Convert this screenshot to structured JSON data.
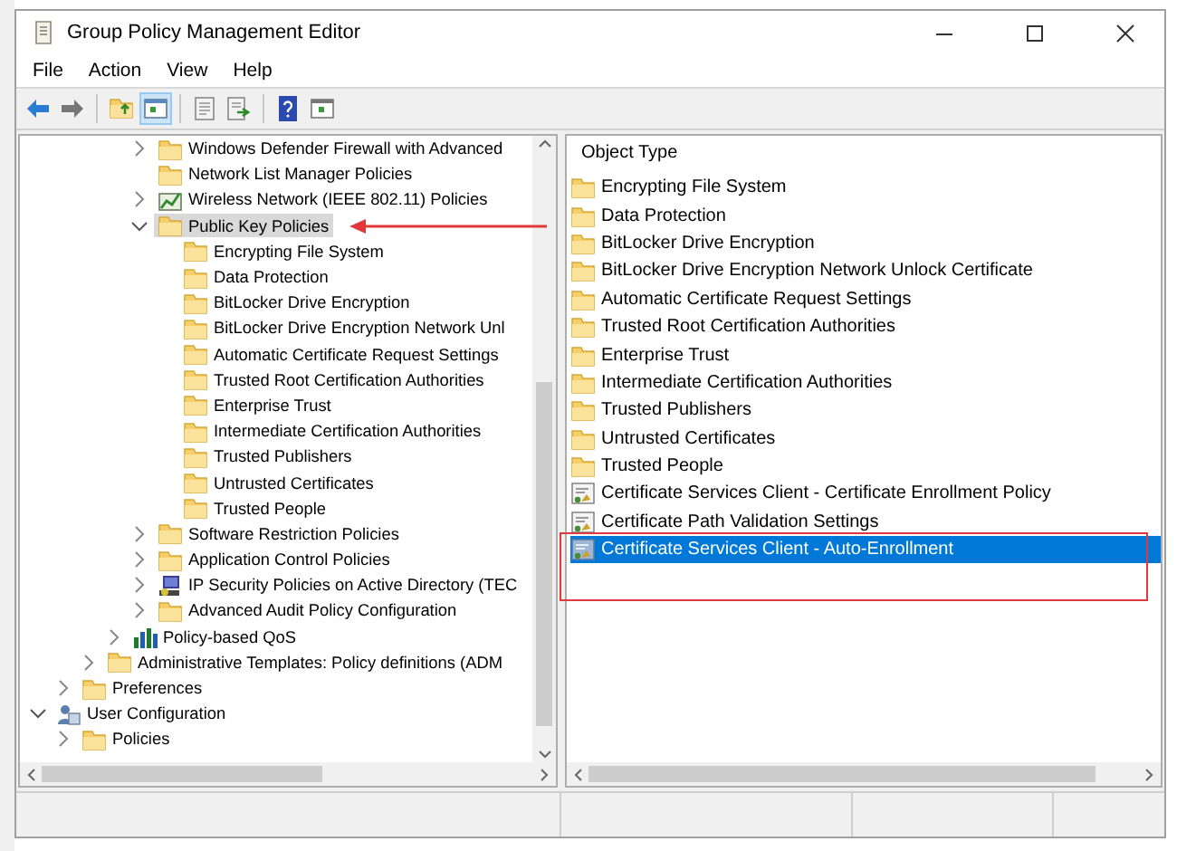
{
  "window": {
    "title": "Group Policy Management Editor"
  },
  "menu": [
    "File",
    "Action",
    "View",
    "Help"
  ],
  "toolbar": [
    {
      "kind": "back",
      "pressed": false
    },
    {
      "kind": "forward",
      "pressed": false
    },
    {
      "kind": "up",
      "pressed": false
    },
    {
      "kind": "tree",
      "pressed": true
    },
    {
      "kind": "sheet",
      "pressed": false
    },
    {
      "kind": "export",
      "pressed": false
    },
    {
      "kind": "help",
      "pressed": false
    },
    {
      "kind": "view",
      "pressed": false
    }
  ],
  "tree": [
    {
      "children": [
        {
          "children": [
            {
              "children": [
                {
                  "children": [
                    {
                      "label": "Windows Defender Firewall with Advanced",
                      "kind": "folder",
                      "expanded": false,
                      "selected": false
                    },
                    {
                      "label": "Network List Manager Policies",
                      "kind": "folder",
                      "selected": false
                    },
                    {
                      "label": "Wireless Network (IEEE 802.11) Policies",
                      "kind": "wireless",
                      "expanded": false,
                      "selected": false
                    },
                    {
                      "label": "Public Key Policies",
                      "kind": "folder",
                      "expanded": true,
                      "selected": true,
                      "children": [
                        {
                          "label": "Encrypting File System",
                          "kind": "folder",
                          "selected": false
                        },
                        {
                          "label": "Data Protection",
                          "kind": "folder",
                          "selected": false
                        },
                        {
                          "label": "BitLocker Drive Encryption",
                          "kind": "folder",
                          "selected": false
                        },
                        {
                          "label": "BitLocker Drive Encryption Network Unl",
                          "kind": "folder",
                          "selected": false
                        },
                        {
                          "label": "Automatic Certificate Request Settings",
                          "kind": "folder",
                          "selected": false
                        },
                        {
                          "label": "Trusted Root Certification Authorities",
                          "kind": "folder",
                          "selected": false
                        },
                        {
                          "label": "Enterprise Trust",
                          "kind": "folder",
                          "selected": false
                        },
                        {
                          "label": "Intermediate Certification Authorities",
                          "kind": "folder",
                          "selected": false
                        },
                        {
                          "label": "Trusted Publishers",
                          "kind": "folder",
                          "selected": false
                        },
                        {
                          "label": "Untrusted Certificates",
                          "kind": "folder",
                          "selected": false
                        },
                        {
                          "label": "Trusted People",
                          "kind": "folder",
                          "selected": false
                        }
                      ]
                    },
                    {
                      "label": "Software Restriction Policies",
                      "kind": "folder",
                      "expanded": false,
                      "selected": false
                    },
                    {
                      "label": "Application Control Policies",
                      "kind": "folder",
                      "expanded": false,
                      "selected": false
                    },
                    {
                      "label": "IP Security Policies on Active Directory (TEC",
                      "kind": "ipsec",
                      "expanded": false,
                      "selected": false
                    },
                    {
                      "label": "Advanced Audit Policy Configuration",
                      "kind": "folder",
                      "expanded": false,
                      "selected": false
                    }
                  ]
                },
                {
                  "label": "Policy-based QoS",
                  "kind": "chart",
                  "expanded": false,
                  "selected": false
                }
              ]
            },
            {
              "label": "Administrative Templates: Policy definitions (ADM",
              "kind": "folder",
              "expanded": false,
              "selected": false
            }
          ]
        },
        {
          "label": "Preferences",
          "kind": "folder",
          "expanded": false,
          "selected": false
        }
      ]
    },
    {
      "label": "User Configuration",
      "kind": "users",
      "expanded": true,
      "selected": false,
      "children": [
        {
          "label": "Policies",
          "kind": "folder",
          "expanded": false,
          "selected": false
        }
      ]
    }
  ],
  "list": {
    "column": "Object Type",
    "items": [
      {
        "label": "Encrypting File System",
        "kind": "folder",
        "selected": false
      },
      {
        "label": "Data Protection",
        "kind": "folder",
        "selected": false
      },
      {
        "label": "BitLocker Drive Encryption",
        "kind": "folder",
        "selected": false
      },
      {
        "label": "BitLocker Drive Encryption Network Unlock Certificate",
        "kind": "folder",
        "selected": false
      },
      {
        "label": "Automatic Certificate Request Settings",
        "kind": "folder",
        "selected": false
      },
      {
        "label": "Trusted Root Certification Authorities",
        "kind": "folder",
        "selected": false
      },
      {
        "label": "Enterprise Trust",
        "kind": "folder",
        "selected": false
      },
      {
        "label": "Intermediate Certification Authorities",
        "kind": "folder",
        "selected": false
      },
      {
        "label": "Trusted Publishers",
        "kind": "folder",
        "selected": false
      },
      {
        "label": "Untrusted Certificates",
        "kind": "folder",
        "selected": false
      },
      {
        "label": "Trusted People",
        "kind": "folder",
        "selected": false
      },
      {
        "label": "Certificate Services Client - Certificate Enrollment Policy",
        "kind": "setting",
        "selected": false
      },
      {
        "label": "Certificate Path Validation Settings",
        "kind": "setting",
        "selected": false
      },
      {
        "label": "Certificate Services Client - Auto-Enrollment",
        "kind": "setting",
        "selected": true
      }
    ]
  }
}
